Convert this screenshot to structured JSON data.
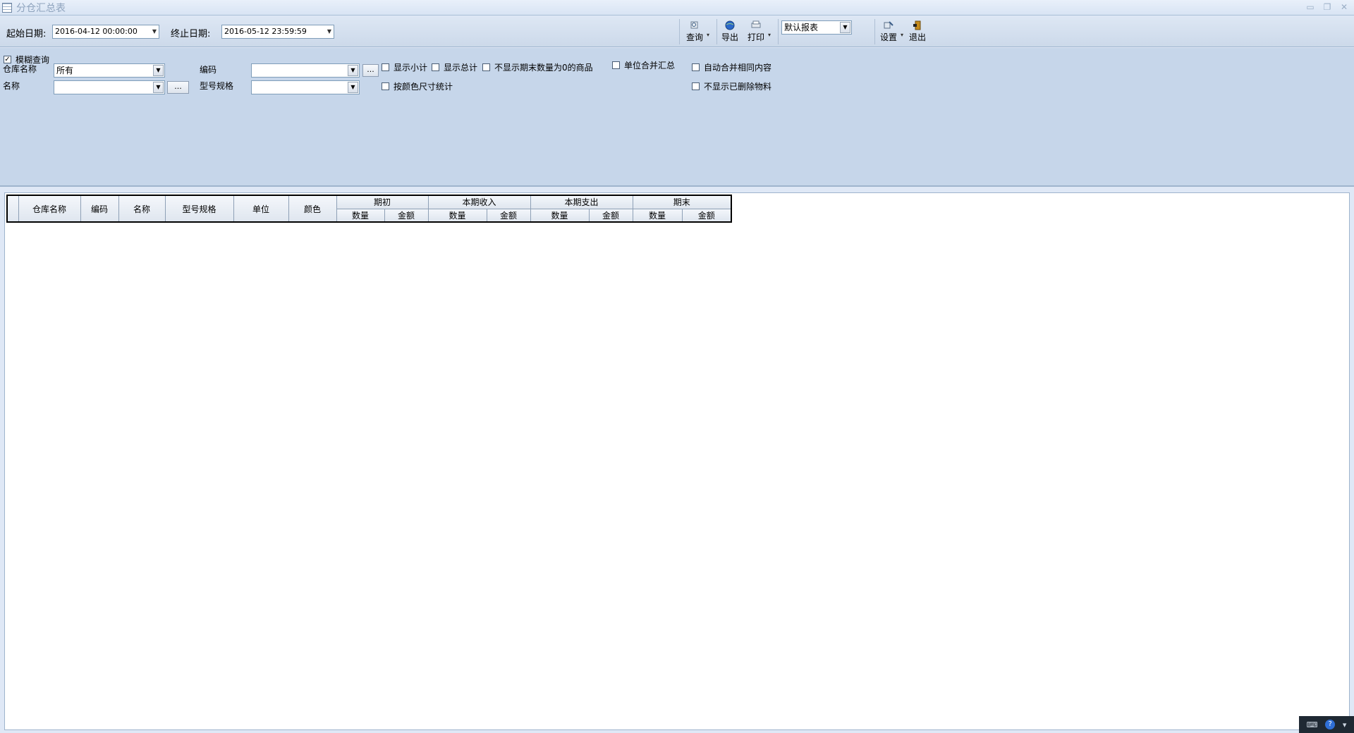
{
  "window": {
    "title": "分仓汇总表"
  },
  "toolbar": {
    "start_date_label": "起始日期:",
    "start_date_value": "2016-04-12 00:00:00",
    "end_date_label": "终止日期:",
    "end_date_value": "2016-05-12 23:59:59",
    "query_label": "查询",
    "export_label": "导出",
    "print_label": "打印",
    "report_select_value": "默认报表",
    "settings_label": "设置",
    "exit_label": "退出"
  },
  "filters": {
    "fuzzy_query_label": "模糊查询",
    "fuzzy_query_checked": true,
    "warehouse_label": "仓库名称",
    "warehouse_value": "所有",
    "name_label": "名称",
    "name_value": "",
    "code_label": "编码",
    "code_value": "",
    "model_label": "型号规格",
    "model_value": "",
    "ellipsis": "...",
    "checkboxes": {
      "show_subtotal": "显示小计",
      "show_total": "显示总计",
      "hide_zero_end_qty": "不显示期末数量为0的商品",
      "unit_merge_summary": "单位合并汇总",
      "auto_merge_same": "自动合并相同内容",
      "by_color_size": "按颜色尺寸统计",
      "hide_deleted_materials": "不显示已删除物料"
    }
  },
  "grid": {
    "columns": {
      "warehouse_name": "仓库名称",
      "code": "编码",
      "name": "名称",
      "model_spec": "型号规格",
      "unit": "单位",
      "color": "颜色"
    },
    "groups": {
      "opening": "期初",
      "receipts": "本期收入",
      "issues": "本期支出",
      "closing": "期末"
    },
    "sub": {
      "qty": "数量",
      "amount": "金额"
    }
  }
}
